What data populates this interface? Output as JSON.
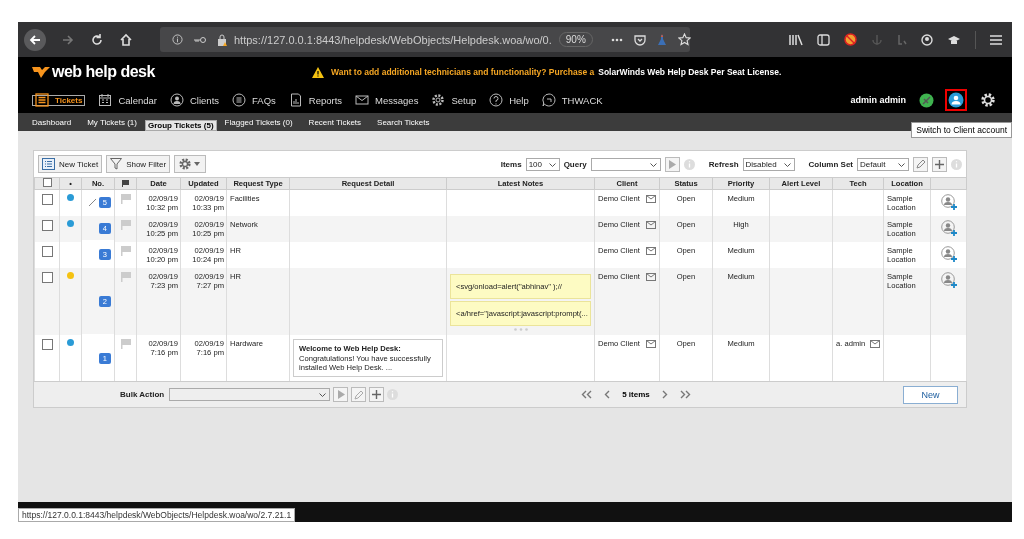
{
  "browser": {
    "url": "https://127.0.0.1:8443/helpdesk/WebObjects/Helpdesk.woa/wo/0.",
    "zoom": "90%",
    "status_url": "https://127.0.0.1:8443/helpdesk/WebObjects/Helpdesk.woa/wo/2.7.21.1"
  },
  "header": {
    "logo": "web help desk",
    "banner": "Want to add additional technicians and functionality? Purchase a",
    "banner_link": "SolarWinds Web Help Desk Per Seat License."
  },
  "nav": [
    {
      "label": "Tickets",
      "kind": "list",
      "selected": true
    },
    {
      "label": "Calendar",
      "kind": "calendar",
      "selected": false
    },
    {
      "label": "Clients",
      "kind": "person",
      "selected": false
    },
    {
      "label": "FAQs",
      "kind": "faq",
      "selected": false
    },
    {
      "label": "Reports",
      "kind": "report",
      "selected": false
    },
    {
      "label": "Messages",
      "kind": "mail",
      "selected": false
    },
    {
      "label": "Setup",
      "kind": "gear",
      "selected": false
    },
    {
      "label": "Help",
      "kind": "help",
      "selected": false
    },
    {
      "label": "THWACK",
      "kind": "chat",
      "selected": false
    }
  ],
  "user": {
    "name": "admin admin",
    "tooltip": "Switch to Client account"
  },
  "subtabs": [
    {
      "label": "Dashboard",
      "selected": false
    },
    {
      "label": "My Tickets (1)",
      "selected": false
    },
    {
      "label": "Group Tickets (5)",
      "selected": true
    },
    {
      "label": "Flagged Tickets (0)",
      "selected": false
    },
    {
      "label": "Recent Tickets",
      "selected": false
    },
    {
      "label": "Search Tickets",
      "selected": false
    }
  ],
  "toolbar": {
    "new_ticket": "New Ticket",
    "show_filter": "Show Filter",
    "items_label": "Items",
    "items_value": "100",
    "query_label": "Query",
    "refresh_label": "Refresh",
    "refresh_value": "Disabled",
    "column_set_label": "Column Set",
    "column_set_value": "Default"
  },
  "table": {
    "all_checked": false,
    "columns": [
      "•",
      "No.",
      "Date",
      "Updated",
      "Request Type",
      "Request Detail",
      "Latest Notes",
      "Client",
      "Status",
      "Priority",
      "Alert Level",
      "Tech",
      "Location"
    ],
    "rows": [
      {
        "checked": false,
        "color": "#2a9bd6",
        "editing": true,
        "no": "5",
        "date": "02/09/19 10:32 pm",
        "updated": "02/09/19 10:33 pm",
        "type": "Facilities",
        "detail": null,
        "notes": [],
        "more_notes": false,
        "client": "Demo Client",
        "status": "Open",
        "priority": "Medium",
        "tech": "",
        "location": "Sample Location"
      },
      {
        "checked": false,
        "color": "#2a9bd6",
        "editing": false,
        "no": "4",
        "date": "02/09/19 10:25 pm",
        "updated": "02/09/19 10:25 pm",
        "type": "Network",
        "detail": null,
        "notes": [],
        "more_notes": false,
        "client": "Demo Client",
        "status": "Open",
        "priority": "High",
        "tech": "",
        "location": "Sample Location"
      },
      {
        "checked": false,
        "editing": false,
        "no": "3",
        "date": "02/09/19 10:20 pm",
        "updated": "02/09/19 10:24 pm",
        "type": "HR",
        "detail": null,
        "notes": [],
        "more_notes": false,
        "client": "Demo Client",
        "status": "Open",
        "priority": "Medium",
        "tech": "",
        "location": "Sample Location"
      },
      {
        "checked": false,
        "color": "#f5c211",
        "editing": false,
        "no": "2",
        "date": "02/09/19 7:23 pm",
        "updated": "02/09/19 7:27 pm",
        "type": "HR",
        "detail": null,
        "notes": [
          "<svg/onload=alert(\"abhinav\" );//",
          "<a/href=\"javascript:javascript:prompt(..."
        ],
        "more_notes": true,
        "client": "Demo Client",
        "status": "Open",
        "priority": "Medium",
        "tech": "",
        "location": "Sample Location"
      },
      {
        "checked": false,
        "color": "#2a9bd6",
        "editing": false,
        "no": "1",
        "date": "02/09/19 7:16 pm",
        "updated": "02/09/19 7:16 pm",
        "type": "Hardware",
        "detail": {
          "title": "Welcome to Web Help Desk:",
          "text": "Congratulations! You have successfully installed Web Help Desk. ..."
        },
        "notes": [],
        "more_notes": false,
        "client": "Demo Client",
        "status": "Open",
        "priority": "Medium",
        "tech": "a. admin",
        "location": ""
      }
    ]
  },
  "footer": {
    "bulk_action": "Bulk Action",
    "count": "5 items",
    "new_button": "New"
  }
}
